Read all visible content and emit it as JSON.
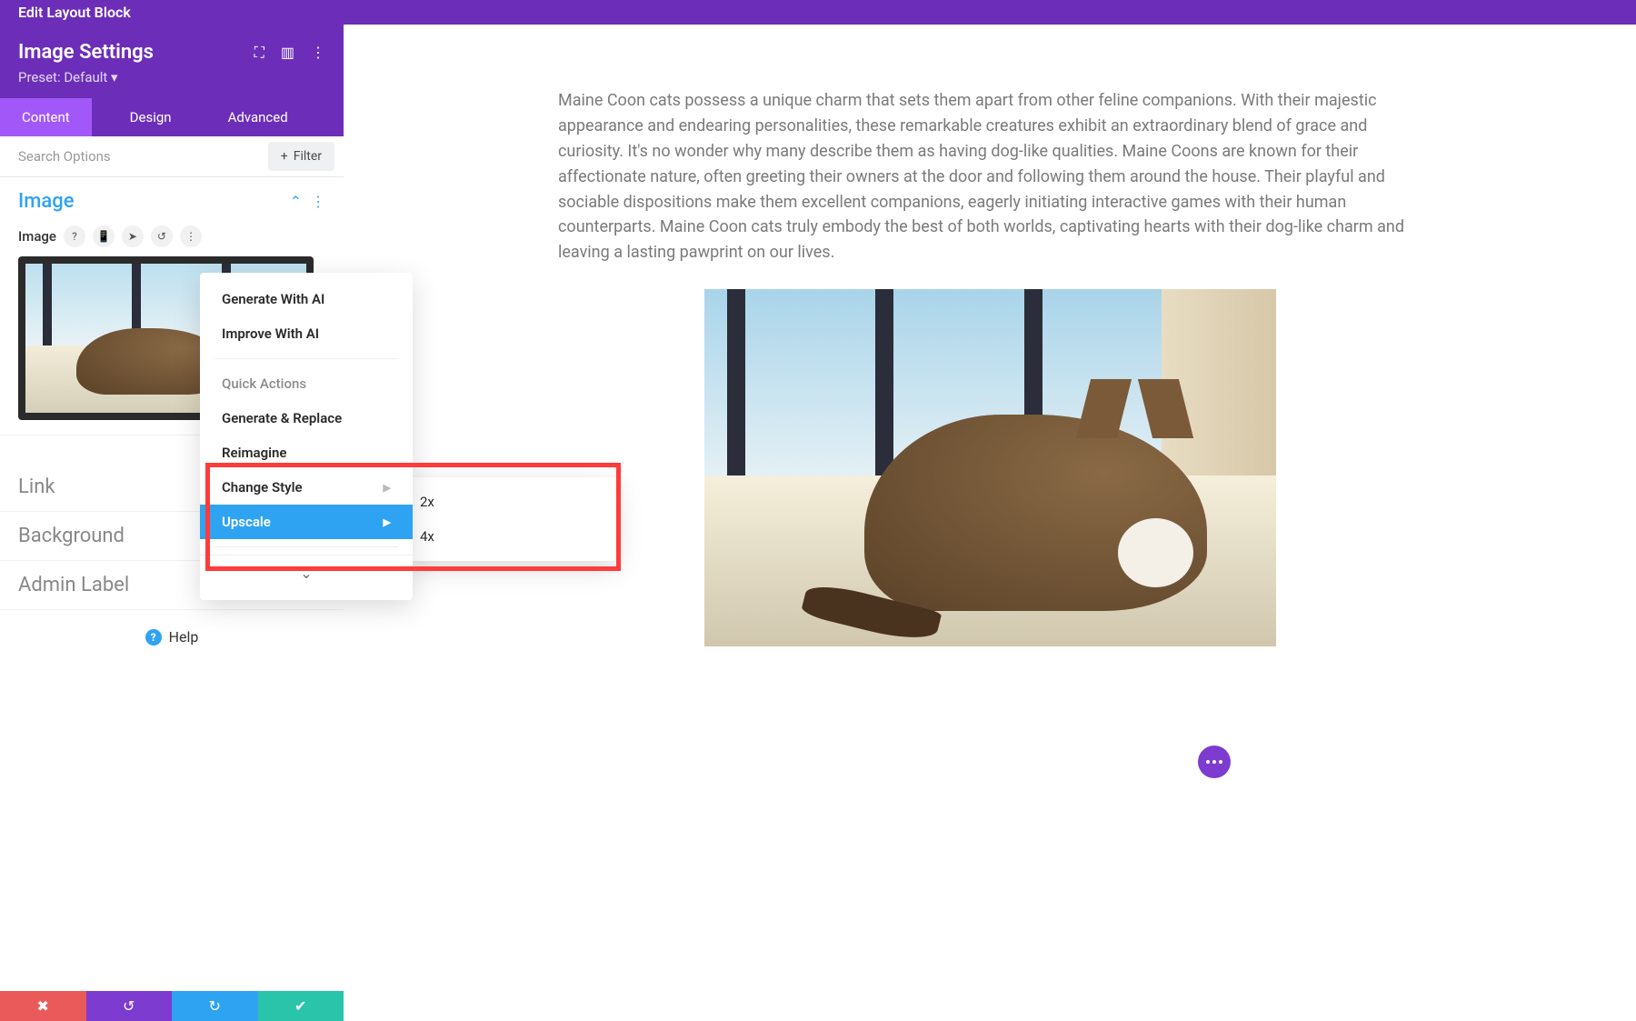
{
  "topbar": {
    "title": "Edit Layout Block"
  },
  "panel": {
    "title": "Image Settings",
    "preset_label": "Preset: Default ▾"
  },
  "tabs": {
    "content": "Content",
    "design": "Design",
    "advanced": "Advanced"
  },
  "search": {
    "placeholder": "Search Options"
  },
  "filter": {
    "label": "Filter",
    "plus": "+"
  },
  "section": {
    "image_title": "Image",
    "image_field_label": "Image",
    "link_title": "Link",
    "background_title": "Background",
    "admin_label_title": "Admin Label"
  },
  "dropdown": {
    "generate_ai": "Generate With AI",
    "improve_ai": "Improve With AI",
    "quick_actions": "Quick Actions",
    "generate_replace": "Generate & Replace",
    "reimagine": "Reimagine",
    "change_style": "Change Style",
    "upscale": "Upscale"
  },
  "submenu": {
    "x2": "2x",
    "x4": "4x"
  },
  "help": {
    "label": "Help"
  },
  "content_text": "Maine Coon cats possess a unique charm that sets them apart from other feline companions. With their majestic appearance and endearing personalities, these remarkable creatures exhibit an extraordinary blend of grace and curiosity. It's no wonder why many describe them as having dog-like qualities. Maine Coons are known for their affectionate nature, often greeting their owners at the door and following them around the house. Their playful and sociable dispositions make them excellent companions, eagerly initiating interactive games with their human counterparts. Maine Coon cats truly embody the best of both worlds, captivating hearts with their dog-like charm and leaving a lasting pawprint on our lives.",
  "icons": {
    "help_q": "?",
    "phone": "📱",
    "cursor": "➤",
    "reset": "↺",
    "more": "⋮",
    "chevron_up": "⌃",
    "chevron_down": "⌄",
    "expand": "⛶",
    "columns": "▥",
    "gear": "✿",
    "trash": "🗑",
    "caret_right": "▶",
    "close": "✖",
    "undo": "↺",
    "redo": "↻",
    "check": "✔"
  }
}
